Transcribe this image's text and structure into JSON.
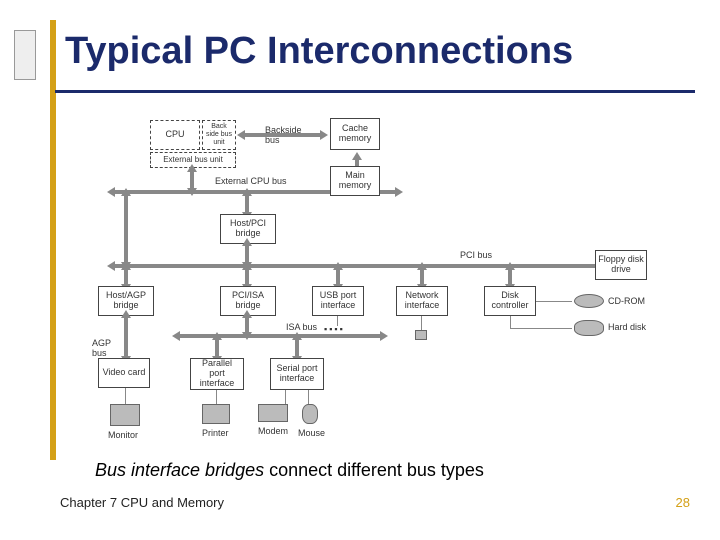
{
  "title": "Typical PC Interconnections",
  "caption_emph": "Bus interface bridges",
  "caption_rest": " connect different bus types",
  "footer": "Chapter 7 CPU and Memory",
  "page_number": "28",
  "diagram": {
    "boxes": {
      "cpu": "CPU",
      "backside": "Back side bus unit",
      "backside_bus": "Backside bus",
      "cache": "Cache memory",
      "ext_bus_unit": "External bus unit",
      "ext_cpu_bus_label": "External CPU bus",
      "main_mem": "Main memory",
      "host_pci": "Host/PCI bridge",
      "pci_bus_label": "PCI bus",
      "host_agp": "Host/AGP bridge",
      "pci_isa": "PCI/ISA bridge",
      "usb": "USB port interface",
      "net": "Network interface",
      "disk_ctrl": "Disk controller",
      "floppy": "Floppy disk drive",
      "cdrom": "CD-ROM",
      "harddisk": "Hard disk",
      "agp_bus_label": "AGP bus",
      "isa_bus_label": "ISA bus",
      "video": "Video card",
      "parallel": "Parallel port interface",
      "serial": "Serial port interface",
      "monitor": "Monitor",
      "printer": "Printer",
      "modem": "Modem",
      "mouse": "Mouse"
    }
  }
}
